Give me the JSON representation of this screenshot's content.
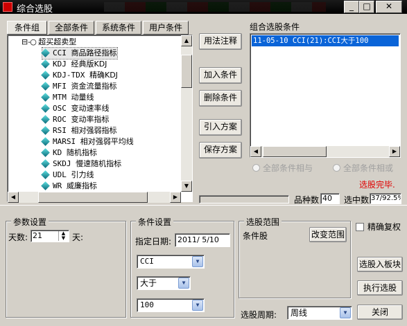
{
  "window": {
    "title": "综合选股",
    "minimize_label": "_",
    "maximize_label": "□",
    "close_label": "✕"
  },
  "tabs": [
    {
      "label": "条件组"
    },
    {
      "label": "全部条件"
    },
    {
      "label": "系统条件"
    },
    {
      "label": "用户条件"
    }
  ],
  "tree": {
    "root_expander": "⊟",
    "root_label": "超买超卖型",
    "items": [
      {
        "code": "CCI",
        "name": "商品路径指标",
        "selected": true
      },
      {
        "code": "KDJ",
        "name": "经典版KDJ"
      },
      {
        "code": "KDJ-TDX",
        "name": "精确KDJ"
      },
      {
        "code": "MFI",
        "name": "资金流量指标"
      },
      {
        "code": "MTM",
        "name": "动量线"
      },
      {
        "code": "OSC",
        "name": "变动速率线"
      },
      {
        "code": "ROC",
        "name": "变动率指标"
      },
      {
        "code": "RSI",
        "name": "相对强弱指标"
      },
      {
        "code": "MARSI",
        "name": "相对强弱平均线"
      },
      {
        "code": "KD",
        "name": "随机指标"
      },
      {
        "code": "SKDJ",
        "name": "慢速随机指标"
      },
      {
        "code": "UDL",
        "name": "引力线"
      },
      {
        "code": "WR",
        "name": "威廉指标"
      }
    ]
  },
  "middle_buttons": {
    "usage": "用法注释",
    "add": "加入条件",
    "delete": "删除条件",
    "import": "引入方案",
    "save": "保存方案"
  },
  "combo_conditions": {
    "heading": "组合选股条件",
    "items": [
      "11-05-10 CCI(21):CCI大于100"
    ]
  },
  "logic": {
    "and_label": "全部条件相与",
    "or_label": "全部条件相或"
  },
  "status": {
    "done_text": "选股完毕.",
    "count_label": "品种数",
    "count_value": "40",
    "selected_label": "选中数",
    "selected_value": "37/92.5%",
    "status_color": "#e00000"
  },
  "params": {
    "heading": "参数设置",
    "days_label": "天数:",
    "days_value": "21",
    "days_unit": "天:"
  },
  "cond_settings": {
    "heading": "条件设置",
    "date_label": "指定日期:",
    "date_value": "2011/ 5/10",
    "indicator_value": "CCI",
    "operator_value": "大于",
    "threshold_value": "100"
  },
  "range": {
    "heading": "选股范围",
    "text": "条件股",
    "change_button": "改变范围"
  },
  "options": {
    "exact_rights_label": "精确复权",
    "select_to_block": "选股入板块",
    "execute": "执行选股",
    "close": "关闭"
  },
  "period": {
    "label": "选股周期:",
    "value": "周线"
  },
  "colors": {
    "selection": "#0a64d8",
    "window_bg": "#d4d0c8",
    "title_bg": "#000000"
  }
}
